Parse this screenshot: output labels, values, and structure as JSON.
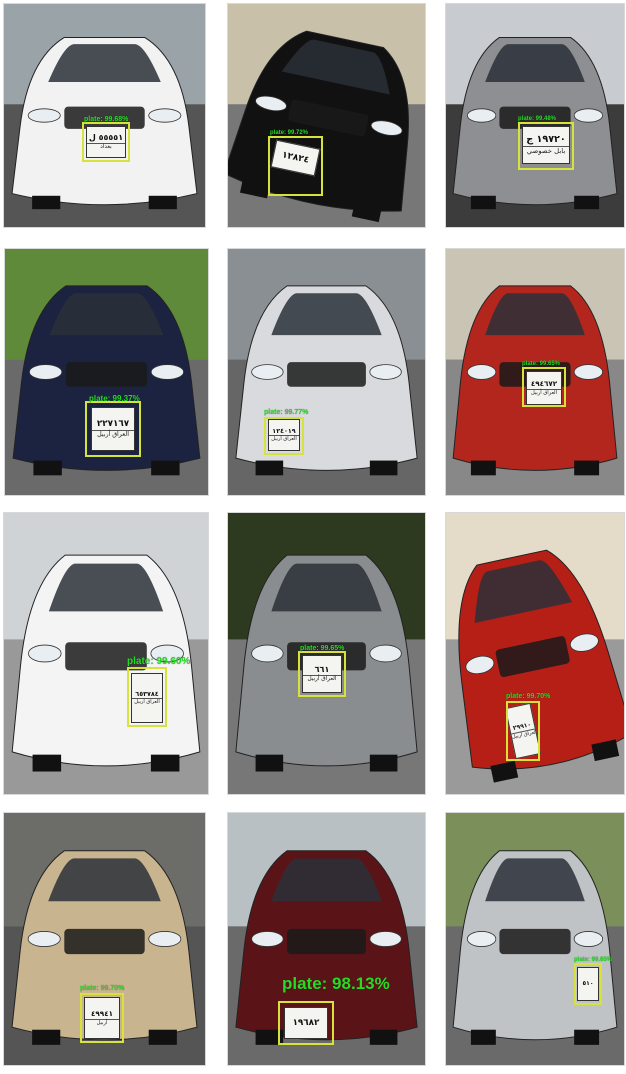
{
  "colors": {
    "box": "#d7e23a",
    "label": "#22dd22",
    "background": "#ffffff"
  },
  "tiles": [
    {
      "label": "plate: 99.68%",
      "plate_number": "٥٥٥٥١ ل",
      "plate_region": "بغداد"
    },
    {
      "label": "plate: 99.72%",
      "plate_number": "١٢٨٢٤",
      "plate_region": ""
    },
    {
      "label": "plate: 99.48%",
      "plate_number": "١٩٧٢٠ ج",
      "plate_region": "بابل خصوصي"
    },
    {
      "label": "plate: 99.37%",
      "plate_number": "٢٢٧١٦٧",
      "plate_region": "العراق أربيل"
    },
    {
      "label": "plate: 99.77%",
      "plate_number": "١٢٤٠١٩",
      "plate_region": "العراق أربيل"
    },
    {
      "label": "plate: 99.65%",
      "plate_number": "٤٩٤٦٧٢",
      "plate_region": "العراق أربيل"
    },
    {
      "label": "plate: 99.60%",
      "plate_number": "٦٥٣٧٨٤",
      "plate_region": "العراق أربيل"
    },
    {
      "label": "plate: 99.65%",
      "plate_number": "٦٦١",
      "plate_region": "العراق أربيل"
    },
    {
      "label": "plate: 99.70%",
      "plate_number": "٢٩٩١٠",
      "plate_region": "العراق أربيل"
    },
    {
      "label": "plate: 99.70%",
      "plate_number": "٤٩٩٤١",
      "plate_region": "أربيل"
    },
    {
      "label": "plate: 98.13%",
      "plate_number": "١٩٦٨٢",
      "plate_region": ""
    },
    {
      "label": "plate: 99.65%",
      "plate_number": "٥١٠",
      "plate_region": ""
    }
  ]
}
